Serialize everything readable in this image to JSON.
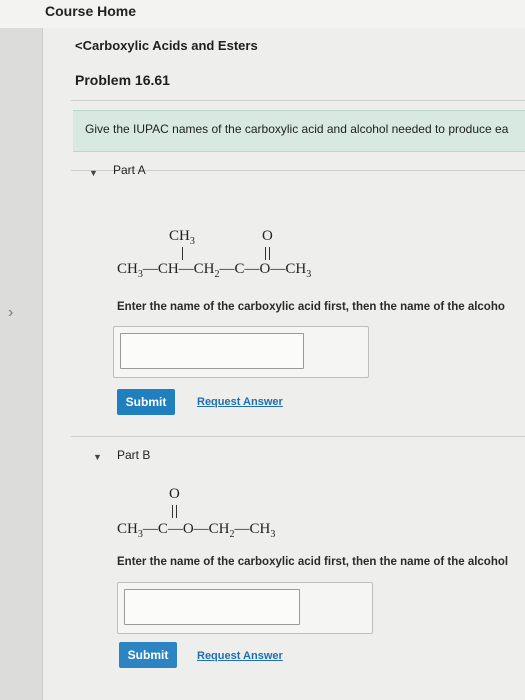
{
  "header": {
    "title": "Course Home"
  },
  "breadcrumb": {
    "label": "Carboxylic Acids and Esters"
  },
  "problem": {
    "title": "Problem 16.61"
  },
  "instruction": "Give the IUPAC names of the carboxylic acid and alcohol needed to produce ea",
  "parts": [
    {
      "label": "Part A",
      "structure": {
        "branch_top": "CH3",
        "carbonyl_o": "O",
        "chain": [
          "CH3",
          "CH",
          "CH2",
          "C",
          "O",
          "CH3"
        ]
      },
      "prompt": "Enter the name of the carboxylic acid first, then the name of the alcoho",
      "input_value": "",
      "submit_label": "Submit",
      "request_label": "Request Answer"
    },
    {
      "label": "Part B",
      "structure": {
        "carbonyl_o": "O",
        "chain": [
          "CH3",
          "C",
          "O",
          "CH2",
          "CH3"
        ]
      },
      "prompt": "Enter the name of the carboxylic acid first, then the name of the alcohol",
      "input_value": "",
      "submit_label": "Submit",
      "request_label": "Request Answer"
    }
  ],
  "colors": {
    "accent": "#1f7fbf",
    "link": "#1f6fb0",
    "instruction_bg": "#d7e9e1"
  },
  "icons": {
    "back": "chevron-left-icon",
    "expand": "caret-down-icon",
    "side_nav": "chevron-right-icon"
  }
}
